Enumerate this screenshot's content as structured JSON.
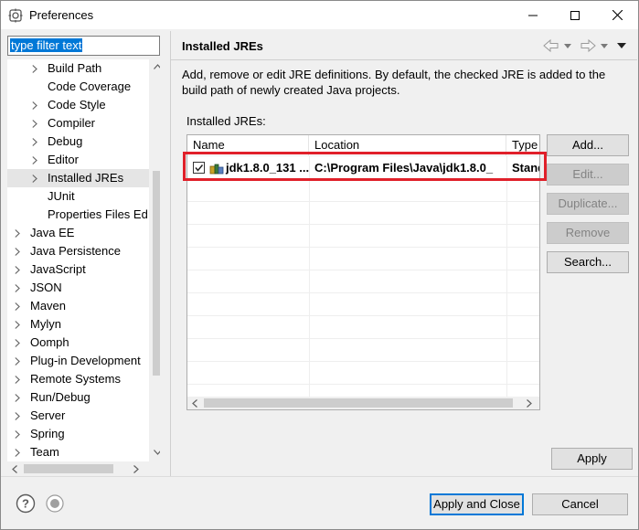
{
  "window": {
    "title": "Preferences"
  },
  "filter": {
    "placeholder": "type filter text"
  },
  "tree": {
    "items": [
      {
        "label": "Build Path",
        "level": 2,
        "arrow": "right"
      },
      {
        "label": "Code Coverage",
        "level": 2,
        "arrow": "none"
      },
      {
        "label": "Code Style",
        "level": 2,
        "arrow": "right"
      },
      {
        "label": "Compiler",
        "level": 2,
        "arrow": "right"
      },
      {
        "label": "Debug",
        "level": 2,
        "arrow": "right"
      },
      {
        "label": "Editor",
        "level": 2,
        "arrow": "right"
      },
      {
        "label": "Installed JREs",
        "level": 2,
        "arrow": "right",
        "selected": true
      },
      {
        "label": "JUnit",
        "level": 2,
        "arrow": "none"
      },
      {
        "label": "Properties Files Ed",
        "level": 2,
        "arrow": "none"
      },
      {
        "label": "Java EE",
        "level": 1,
        "arrow": "right"
      },
      {
        "label": "Java Persistence",
        "level": 1,
        "arrow": "right"
      },
      {
        "label": "JavaScript",
        "level": 1,
        "arrow": "right"
      },
      {
        "label": "JSON",
        "level": 1,
        "arrow": "right"
      },
      {
        "label": "Maven",
        "level": 1,
        "arrow": "right"
      },
      {
        "label": "Mylyn",
        "level": 1,
        "arrow": "right"
      },
      {
        "label": "Oomph",
        "level": 1,
        "arrow": "right"
      },
      {
        "label": "Plug-in Development",
        "level": 1,
        "arrow": "right"
      },
      {
        "label": "Remote Systems",
        "level": 1,
        "arrow": "right"
      },
      {
        "label": "Run/Debug",
        "level": 1,
        "arrow": "right"
      },
      {
        "label": "Server",
        "level": 1,
        "arrow": "right"
      },
      {
        "label": "Spring",
        "level": 1,
        "arrow": "right"
      },
      {
        "label": "Team",
        "level": 1,
        "arrow": "right"
      }
    ]
  },
  "page": {
    "title": "Installed JREs",
    "description": "Add, remove or edit JRE definitions. By default, the checked JRE is added to the build path of newly created Java projects.",
    "list_label": "Installed JREs:"
  },
  "table": {
    "columns": [
      "Name",
      "Location",
      "Type"
    ],
    "rows": [
      {
        "checked": true,
        "name": "jdk1.8.0_131 ...",
        "location": "C:\\Program Files\\Java\\jdk1.8.0_",
        "type": "Stand"
      }
    ]
  },
  "buttons": {
    "add": "Add...",
    "edit": "Edit...",
    "duplicate": "Duplicate...",
    "remove": "Remove",
    "search": "Search...",
    "apply": "Apply",
    "apply_and_close": "Apply and Close",
    "cancel": "Cancel"
  },
  "colors": {
    "highlight": "#e0202a",
    "selection": "#0078d7"
  }
}
